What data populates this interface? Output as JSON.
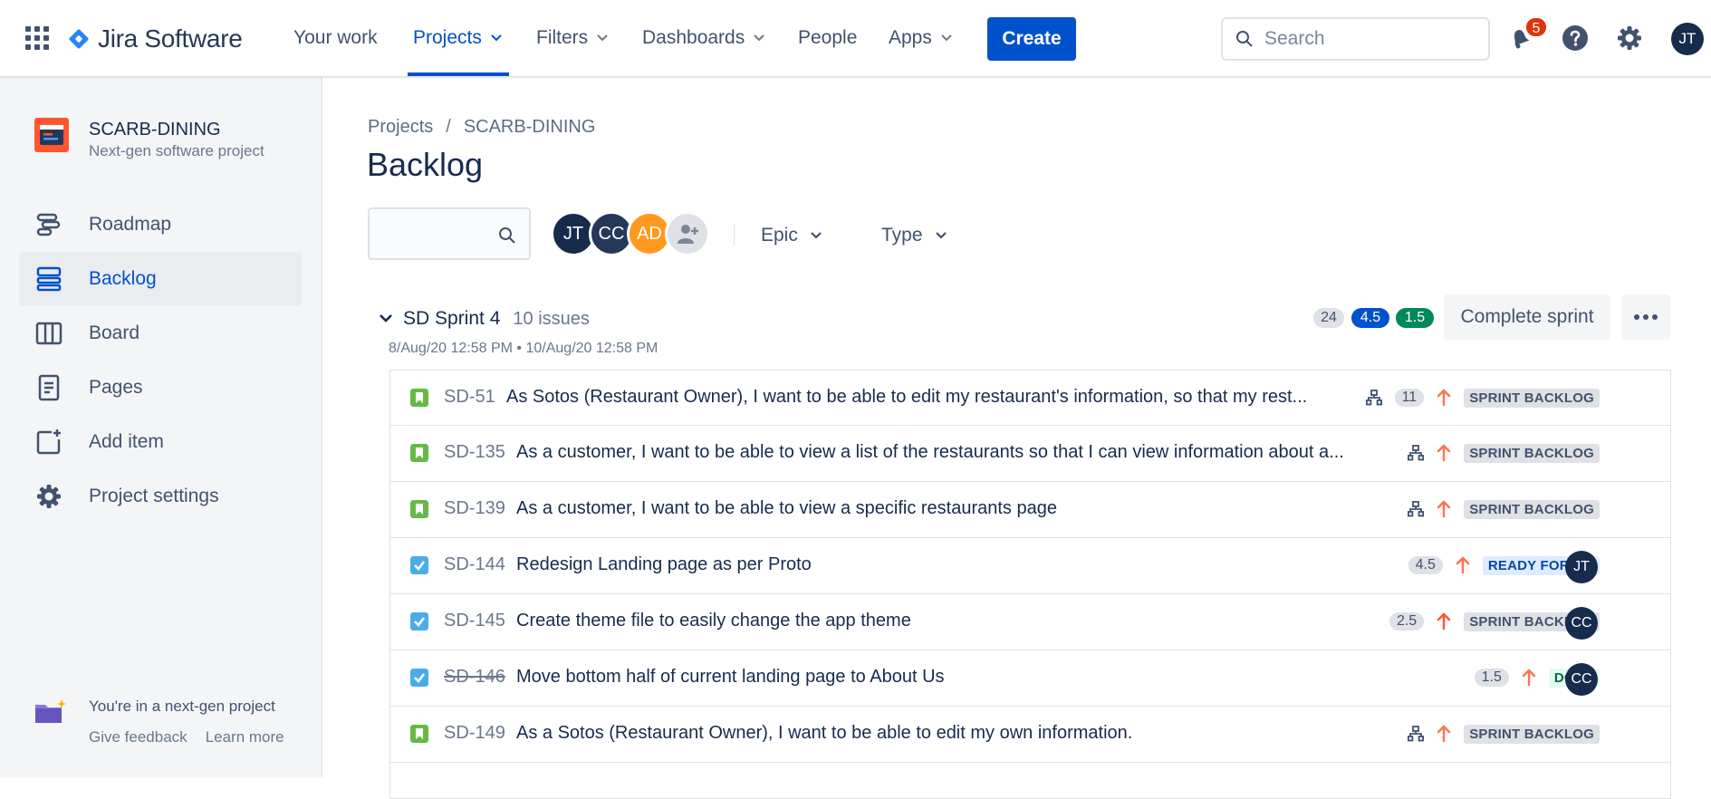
{
  "topnav": {
    "product": "Jira Software",
    "items": [
      {
        "label": "Your work",
        "has_chevron": false
      },
      {
        "label": "Projects",
        "has_chevron": true,
        "active": true
      },
      {
        "label": "Filters",
        "has_chevron": true
      },
      {
        "label": "Dashboards",
        "has_chevron": true
      },
      {
        "label": "People",
        "has_chevron": false
      },
      {
        "label": "Apps",
        "has_chevron": true
      }
    ],
    "create_label": "Create",
    "search_placeholder": "Search",
    "notification_count": "5",
    "user_initials": "JT"
  },
  "sidebar": {
    "project_name": "SCARB-DINING",
    "project_type": "Next-gen software project",
    "items": [
      {
        "label": "Roadmap",
        "icon": "roadmap-icon"
      },
      {
        "label": "Backlog",
        "icon": "backlog-icon",
        "active": true
      },
      {
        "label": "Board",
        "icon": "board-icon"
      },
      {
        "label": "Pages",
        "icon": "pages-icon"
      },
      {
        "label": "Add item",
        "icon": "add-item-icon"
      },
      {
        "label": "Project settings",
        "icon": "gear-icon"
      }
    ],
    "footer_title": "You're in a next-gen project",
    "footer_feedback": "Give feedback",
    "footer_learn": "Learn more"
  },
  "main": {
    "breadcrumb": [
      "Projects",
      "SCARB-DINING"
    ],
    "title": "Backlog",
    "avatars": [
      {
        "initials": "JT",
        "color": "#172b4d"
      },
      {
        "initials": "CC",
        "color": "#253858"
      },
      {
        "initials": "AD",
        "color": "#ff991f"
      }
    ],
    "filters": {
      "epic": "Epic",
      "type": "Type"
    },
    "sprint": {
      "name": "SD Sprint 4",
      "issue_count": "10 issues",
      "dates": "8/Aug/20 12:58 PM • 10/Aug/20 12:58 PM",
      "points_todo": "24",
      "points_in_progress": "4.5",
      "points_done": "1.5",
      "complete_label": "Complete sprint"
    },
    "issues": [
      {
        "type": "story",
        "key": "SD-51",
        "summary": "As Sotos (Restaurant Owner), I want to be able to edit my restaurant's information, so that my rest...",
        "child_icon": true,
        "child_count": "11",
        "priority": "medium",
        "status": "SPRINT BACKLOG",
        "status_style": "gray",
        "assignee": ""
      },
      {
        "type": "story",
        "key": "SD-135",
        "summary": "As a customer, I want to be able to view a list of the restaurants so that I can view information about a...",
        "child_icon": true,
        "child_count": "",
        "priority": "medium",
        "status": "SPRINT BACKLOG",
        "status_style": "gray",
        "assignee": ""
      },
      {
        "type": "story",
        "key": "SD-139",
        "summary": "As a customer, I want to be able to view a specific restaurants page",
        "child_icon": true,
        "child_count": "",
        "priority": "medium",
        "status": "SPRINT BACKLOG",
        "status_style": "gray",
        "assignee": ""
      },
      {
        "type": "task",
        "key": "SD-144",
        "summary": "Redesign Landing page as per Proto",
        "child_icon": false,
        "estimate": "4.5",
        "priority": "medium",
        "status": "READY FOR QA",
        "status_style": "blue",
        "assignee": "JT"
      },
      {
        "type": "task",
        "key": "SD-145",
        "summary": "Create theme file to easily change the app theme",
        "child_icon": false,
        "estimate": "2.5",
        "priority": "high",
        "status": "SPRINT BACKLOG",
        "status_style": "gray",
        "assignee": "CC"
      },
      {
        "type": "task",
        "key": "SD-146",
        "done": true,
        "summary": "Move bottom half of current landing page to About Us",
        "child_icon": false,
        "estimate": "1.5",
        "priority": "medium",
        "status": "DONE",
        "status_style": "green",
        "assignee": "CC"
      },
      {
        "type": "story",
        "key": "SD-149",
        "summary": "As a Sotos (Restaurant Owner), I want to be able to edit my own information.",
        "child_icon": true,
        "child_count": "",
        "priority": "medium",
        "status": "SPRINT BACKLOG",
        "status_style": "gray",
        "assignee": ""
      }
    ]
  },
  "colors": {
    "brand": "#0052cc",
    "story": "#65ba43",
    "task": "#4bade8",
    "priority_medium": "#ff7452",
    "priority_high": "#ff5630",
    "notification": "#de350b"
  }
}
